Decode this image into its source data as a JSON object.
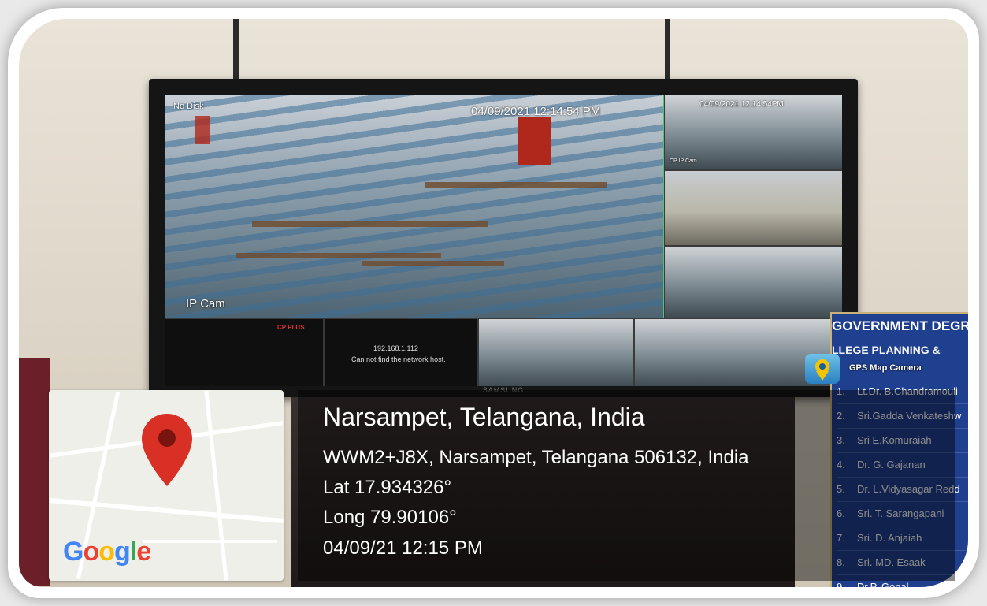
{
  "camera_feed": {
    "main_disk_status": "No Disk",
    "main_timestamp": "04/09/2021 12:14:54 PM",
    "main_camera_label": "IP Cam",
    "side_timestamp": "04/09/2021 12:14:54PM",
    "side_camera_label": "CP IP Cam",
    "brand_label": "CP PLUS",
    "offline_ip": "192.168.1.112",
    "offline_message": "Can not find the network host.",
    "monitor_brand": "SAMSUNG"
  },
  "notice_board": {
    "heading": "GOVERNMENT DEGR",
    "subheading": "LLEGE PLANNING &",
    "items": [
      {
        "num": "1.",
        "name": "Lt.Dr. B.Chandramouli"
      },
      {
        "num": "2.",
        "name": "Sri.Gadda Venkateshw"
      },
      {
        "num": "3.",
        "name": "Sri E.Komuraiah"
      },
      {
        "num": "4.",
        "name": "Dr. G. Gajanan"
      },
      {
        "num": "5.",
        "name": "Dr. L.Vidyasagar Redd"
      },
      {
        "num": "6.",
        "name": "Sri. T. Sarangapani"
      },
      {
        "num": "7.",
        "name": "Sri. D. Anjaiah"
      },
      {
        "num": "8.",
        "name": "Sri. MD. Esaak"
      },
      {
        "num": "9.",
        "name": "Dr.P. Gopal"
      }
    ]
  },
  "gps_overlay": {
    "app_label": "GPS Map Camera",
    "map_provider": "Google",
    "location_title": "Narsampet, Telangana, India",
    "address": "WWM2+J8X, Narsampet, Telangana 506132, India",
    "latitude": "Lat 17.934326°",
    "longitude": "Long 79.90106°",
    "datetime": "04/09/21 12:15 PM"
  },
  "colors": {
    "pin_red": "#d93025",
    "board_blue": "#1f3f8f",
    "feed_highlight": "#48c774"
  }
}
